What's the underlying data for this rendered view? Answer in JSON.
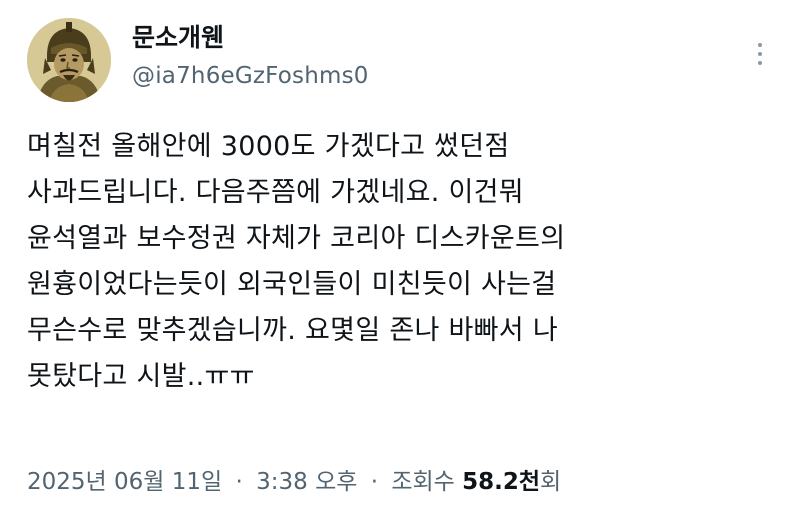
{
  "author": {
    "display_name": "문소개웬",
    "handle": "@ia7h6eGzFoshms0",
    "avatar_icon": "warrior-portrait-avatar"
  },
  "menu": {
    "icon": "more-vertical-icon"
  },
  "tweet": {
    "lines": [
      "며칠전 올해안에 3000도 가겠다고 썼던점",
      "사과드립니다. 다음주쯤에 가겠네요. 이건뭐",
      "윤석열과 보수정권 자체가 코리아 디스카운트의",
      "원흉이었다는듯이 외국인들이 미친듯이 사는걸",
      "무슨수로 맞추겠습니까. 요몇일 존나 바빠서 나",
      "못탔다고 시발..ㅠㅠ"
    ]
  },
  "meta": {
    "date": "2025년 06월 11일",
    "separator": "·",
    "time": "3:38 오후",
    "views_label": "조회수",
    "views_count": "58.2천",
    "views_suffix": "회"
  },
  "colors": {
    "text": "#0f1419",
    "secondary_text": "#536471",
    "background": "#ffffff"
  }
}
